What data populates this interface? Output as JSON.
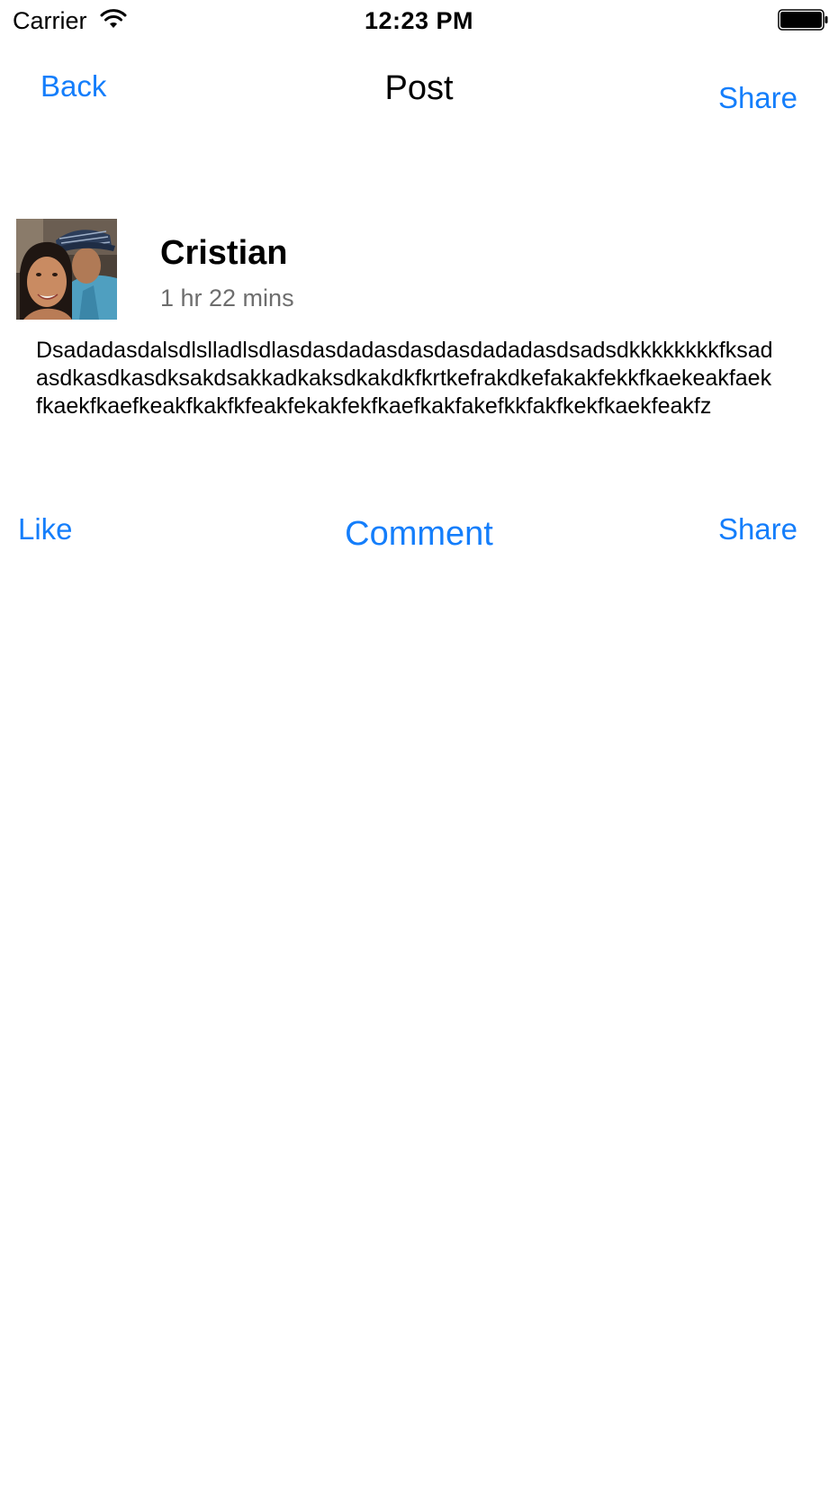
{
  "status_bar": {
    "carrier": "Carrier",
    "time": "12:23 PM",
    "wifi_icon": "wifi-icon",
    "battery_icon": "battery-icon"
  },
  "nav_bar": {
    "back_label": "Back",
    "title": "Post",
    "share_label": "Share"
  },
  "post": {
    "author": "Cristian",
    "time_ago": "1 hr 22 mins",
    "body": "Dsadadasdalsdlslladlsdlasdasdadasdasdasdadadasdsadsdkkkkkkkkfksadasdkasdkasdksakdsakkadkaksdkakdkfkrtkefrakdkefakakfekkfkaekeakfaekfkaekfkaefkeakfkakfkfeakfekakfekfkaefkakfakefkkfakfkekfkaekfeakfz"
  },
  "actions": {
    "like_label": "Like",
    "comment_label": "Comment",
    "share_label": "Share"
  },
  "colors": {
    "tint": "#147efb",
    "secondary_text": "#6d6d6d"
  }
}
